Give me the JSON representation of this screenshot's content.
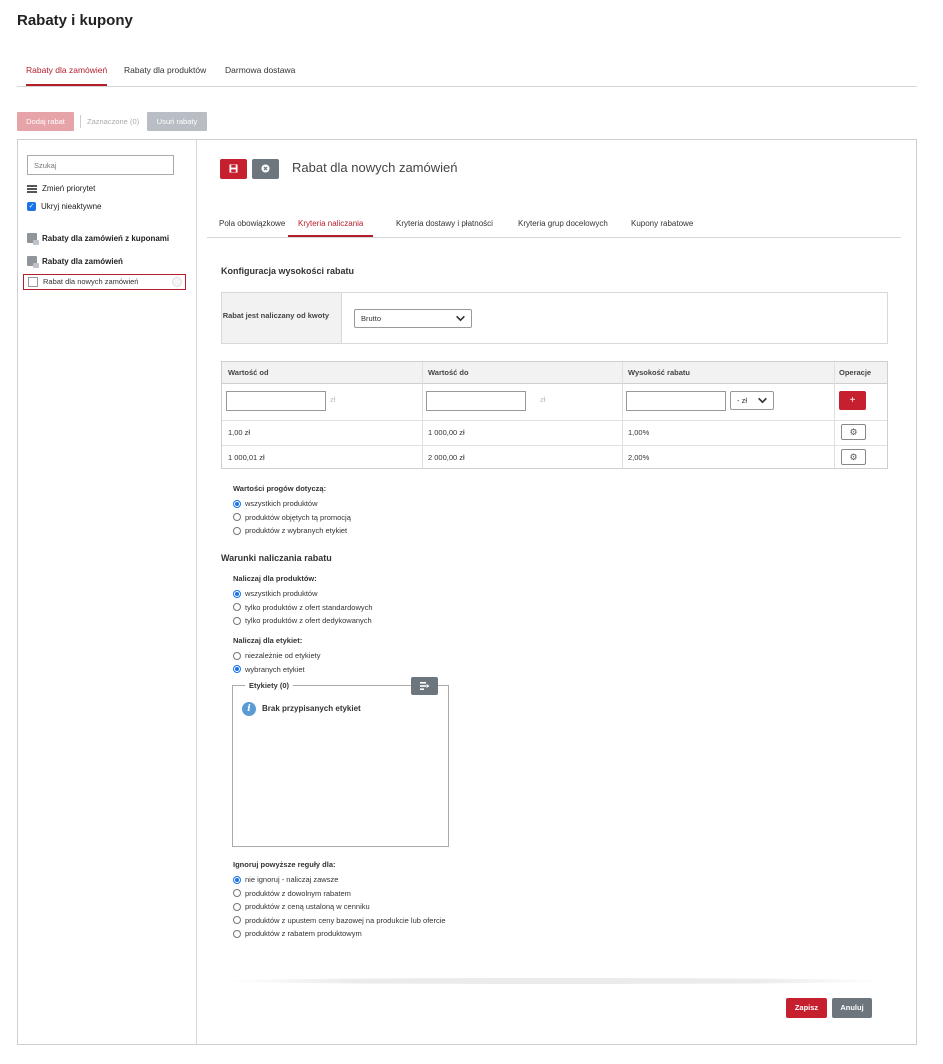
{
  "page": {
    "title": "Rabaty i kupony"
  },
  "top_tabs": [
    {
      "label": "Rabaty dla zamówień"
    },
    {
      "label": "Rabaty dla produktów"
    },
    {
      "label": "Darmowa dostawa"
    }
  ],
  "toolbar": {
    "add_label": "Dodaj rabat",
    "selected_label": "Zaznaczone (0)",
    "remove_label": "Usuń rabaty"
  },
  "sidebar": {
    "search_placeholder": "Szukaj",
    "change_priority": "Zmień priorytet",
    "hide_inactive": "Ukryj nieaktywne",
    "group_coupons": "Rabaty dla zamówień z kuponami",
    "group_orders": "Rabaty dla zamówień",
    "selected_item": "Rabat dla nowych zamówień"
  },
  "rule": {
    "title": "Rabat dla nowych zamówień"
  },
  "sub_tabs": [
    {
      "label": "Pola obowiązkowe"
    },
    {
      "label": "Kryteria naliczania"
    },
    {
      "label": "Kryteria dostawy i płatności"
    },
    {
      "label": "Kryteria grup docelowych"
    },
    {
      "label": "Kupony rabatowe"
    }
  ],
  "config": {
    "section_title": "Konfiguracja wysokości rabatu",
    "calc_label": "Rabat jest naliczany od kwoty",
    "calc_value": "Brutto"
  },
  "table": {
    "headers": [
      "Wartość od",
      "Wartość do",
      "Wysokość rabatu",
      "Operacje"
    ],
    "currency_unit": "zł",
    "discount_unit": "- zł",
    "add_label": "+",
    "rows": [
      {
        "from": "1,00 zł",
        "to": "1 000,00 zł",
        "discount": "1,00%"
      },
      {
        "from": "1 000,01 zł",
        "to": "2 000,00 zł",
        "discount": "2,00%"
      }
    ]
  },
  "thresholds": {
    "title": "Wartości progów dotyczą:",
    "options": [
      "wszystkich produktów",
      "produktów objętych tą promocją",
      "produktów z wybranych etykiet"
    ]
  },
  "conditions": {
    "section_title": "Warunki naliczania rabatu",
    "products_title": "Naliczaj dla produktów:",
    "products_options": [
      "wszystkich produktów",
      "tylko produktów z ofert standardowych",
      "tylko produktów z ofert dedykowanych"
    ],
    "labels_title": "Naliczaj dla etykiet:",
    "labels_options": [
      "niezależnie od etykiety",
      "wybranych etykiet"
    ],
    "labels_box_title": "Etykiety (0)",
    "no_labels": "Brak przypisanych etykiet",
    "ignore_title": "Ignoruj powyższe reguły dla:",
    "ignore_options": [
      "nie ignoruj - naliczaj zawsze",
      "produktów z dowolnym rabatem",
      "produktów z ceną ustaloną w cenniku",
      "produktów z upustem ceny bazowej na produkcie lub ofercie",
      "produktów z rabatem produktowym"
    ]
  },
  "footer": {
    "save_label": "Zapisz",
    "cancel_label": "Anuluj"
  },
  "colors": {
    "accent": "#b51f2b",
    "primary_button": "#c6202f",
    "secondary_button": "#6d757d",
    "radio": "#1a73e8"
  }
}
